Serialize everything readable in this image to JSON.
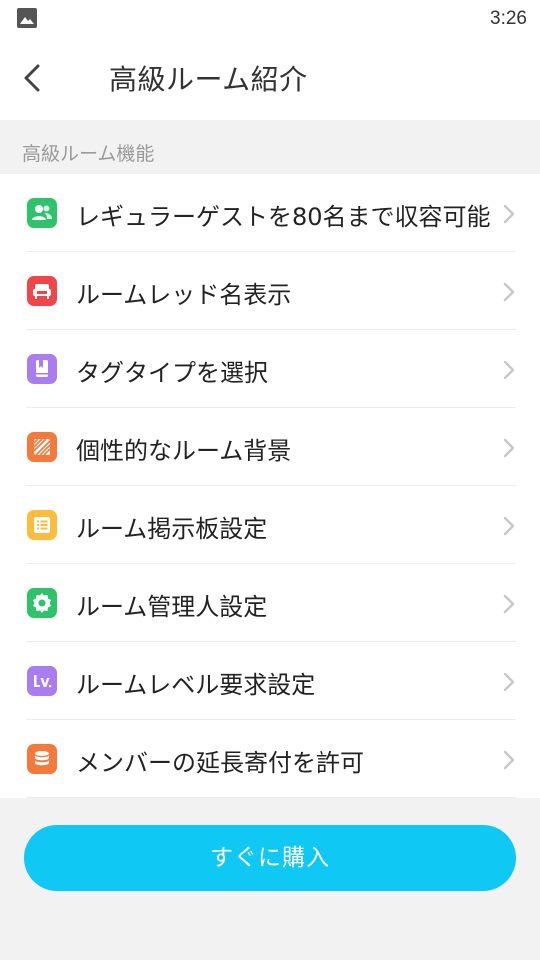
{
  "status_bar": {
    "time": "3:26",
    "left_icon": "photo-icon"
  },
  "header": {
    "title": "高級ルーム紹介",
    "back_icon": "chevron-left-icon"
  },
  "section": {
    "label": "高級ルーム機能"
  },
  "features": [
    {
      "label": "レギュラーゲストを80名まで収容可能",
      "icon": "users-icon",
      "color": "#2ec26a"
    },
    {
      "label": "ルームレッド名表示",
      "icon": "sofa-icon",
      "color": "#f0454a"
    },
    {
      "label": "タグタイプを選択",
      "icon": "bookmark-icon",
      "color": "#a97cf0"
    },
    {
      "label": "個性的なルーム背景",
      "icon": "stripes-icon",
      "color": "#f5793a"
    },
    {
      "label": "ルーム掲示板設定",
      "icon": "list-icon",
      "color": "#fbbd3b"
    },
    {
      "label": "ルーム管理人設定",
      "icon": "gear-icon",
      "color": "#2ec26a"
    },
    {
      "label": "ルームレベル要求設定",
      "icon": "level-icon",
      "color": "#a97cf0"
    },
    {
      "label": "メンバーの延長寄付を許可",
      "icon": "coins-icon",
      "color": "#f5793a"
    }
  ],
  "buy_button": {
    "label": "すぐに購入",
    "color": "#0fc9f4"
  }
}
